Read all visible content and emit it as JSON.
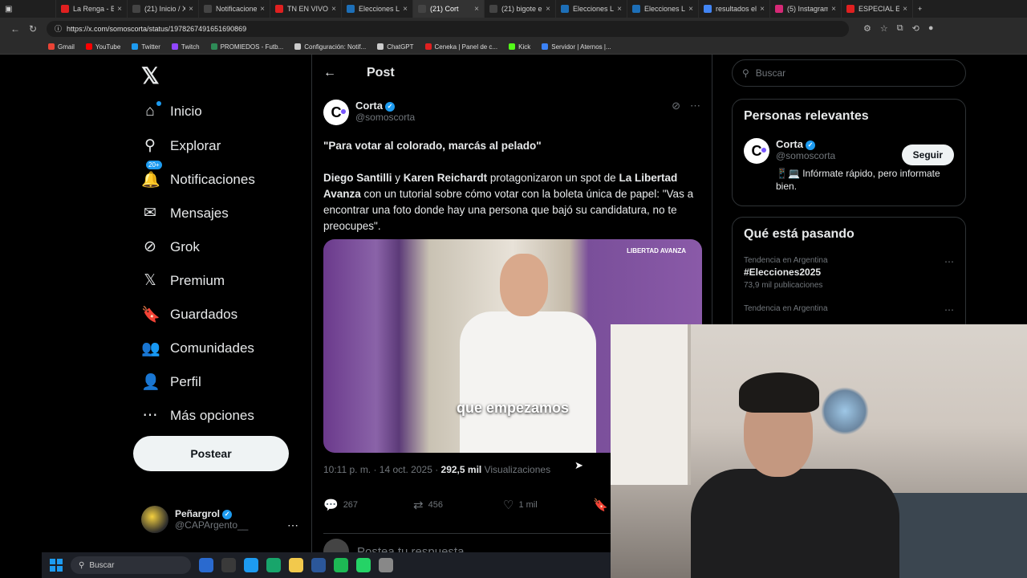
{
  "browser": {
    "tabs": [
      {
        "label": "La Renga - Bal",
        "color": "#e02020"
      },
      {
        "label": "(21) Inicio / X",
        "color": "#000000"
      },
      {
        "label": "Notificaciones",
        "color": "#000000"
      },
      {
        "label": "TN EN VIVO -",
        "color": "#e02020"
      },
      {
        "label": "Elecciones Leg",
        "color": "#1d6fb8"
      },
      {
        "label": "(21) Cort",
        "color": "#000000"
      },
      {
        "label": "(21) bigote en",
        "color": "#000000"
      },
      {
        "label": "Elecciones Leg",
        "color": "#1d6fb8"
      },
      {
        "label": "Elecciones Leg",
        "color": "#1d6fb8"
      },
      {
        "label": "resultados ele",
        "color": "#4285f4"
      },
      {
        "label": "(5) Instagram",
        "color": "#d62976"
      },
      {
        "label": "ESPECIAL ELEC",
        "color": "#e02020"
      }
    ],
    "url": "https://x.com/somoscorta/status/1978267491651690869",
    "bookmarks": [
      {
        "label": "Gmail",
        "color": "#ea4335"
      },
      {
        "label": "YouTube",
        "color": "#ff0000"
      },
      {
        "label": "Twitter",
        "color": "#1d9bf0"
      },
      {
        "label": "Twitch",
        "color": "#9146ff"
      },
      {
        "label": "PROMIEDOS - Futb...",
        "color": "#2e8b57"
      },
      {
        "label": "Configuración: Notif...",
        "color": "#cccccc"
      },
      {
        "label": "ChatGPT",
        "color": "#cccccc"
      },
      {
        "label": "Ceneka | Panel de c...",
        "color": "#e02020"
      },
      {
        "label": "Kick",
        "color": "#53fc18"
      },
      {
        "label": "Servidor | Aternos |...",
        "color": "#3b82f6"
      }
    ]
  },
  "nav": {
    "items": [
      {
        "label": "Inicio",
        "icon": "⌂"
      },
      {
        "label": "Explorar",
        "icon": "⚲"
      },
      {
        "label": "Notificaciones",
        "icon": "🔔",
        "badge": "20+"
      },
      {
        "label": "Mensajes",
        "icon": "✉"
      },
      {
        "label": "Grok",
        "icon": "⊘"
      },
      {
        "label": "Premium",
        "icon": "𝕏"
      },
      {
        "label": "Guardados",
        "icon": "🔖"
      },
      {
        "label": "Comunidades",
        "icon": "👥"
      },
      {
        "label": "Perfil",
        "icon": "👤"
      },
      {
        "label": "Más opciones",
        "icon": "⋯"
      }
    ],
    "post_button": "Postear",
    "user": {
      "name": "Peñargrol",
      "handle": "@CAPArgento__"
    }
  },
  "post": {
    "header": "Post",
    "author_name": "Corta",
    "author_handle": "@somoscorta",
    "headline": "\"Para votar al colorado, marcás al pelado\"",
    "body_parts": {
      "b1": "Diego Santilli",
      "t1": " y ",
      "b2": "Karen Reichardt",
      "t2": " protagonizaron un spot de ",
      "b3": "La Libertad Avanza",
      "t3": " con un tutorial sobre cómo votar con la boleta única de papel: \"Vas a encontrar una foto donde hay una persona que bajó su candidatura, no te preocupes\"."
    },
    "video_caption": "que empezamos",
    "video_brand": "LIBERTAD AVANZA",
    "time": "10:11 p. m. · 14 oct. 2025 · ",
    "views": "292,5 mil",
    "views_label": " Visualizaciones",
    "stats": {
      "replies": "267",
      "reposts": "456",
      "likes": "1 mil"
    },
    "reply_placeholder": "Postea tu respuesta"
  },
  "sidebar": {
    "search_placeholder": "Buscar",
    "relevant_title": "Personas relevantes",
    "relevant_name": "Corta",
    "relevant_handle": "@somoscorta",
    "relevant_bio": "📱💻 Infórmate rápido, pero informate bien.",
    "follow_label": "Seguir",
    "trending_title": "Qué está pasando",
    "trends": [
      {
        "context": "Tendencia en Argentina",
        "topic": "#Elecciones2025",
        "count": "73,9 mil publicaciones"
      },
      {
        "context": "Tendencia en Argentina",
        "topic": "",
        "count": ""
      }
    ]
  },
  "taskbar": {
    "search_label": "Buscar",
    "apps": [
      "#2a6acf",
      "#3a3a3a",
      "#1d9bf0",
      "#18a56b",
      "#f2c94c",
      "#2b579a",
      "#1db954",
      "#25d366",
      "#888888"
    ]
  }
}
